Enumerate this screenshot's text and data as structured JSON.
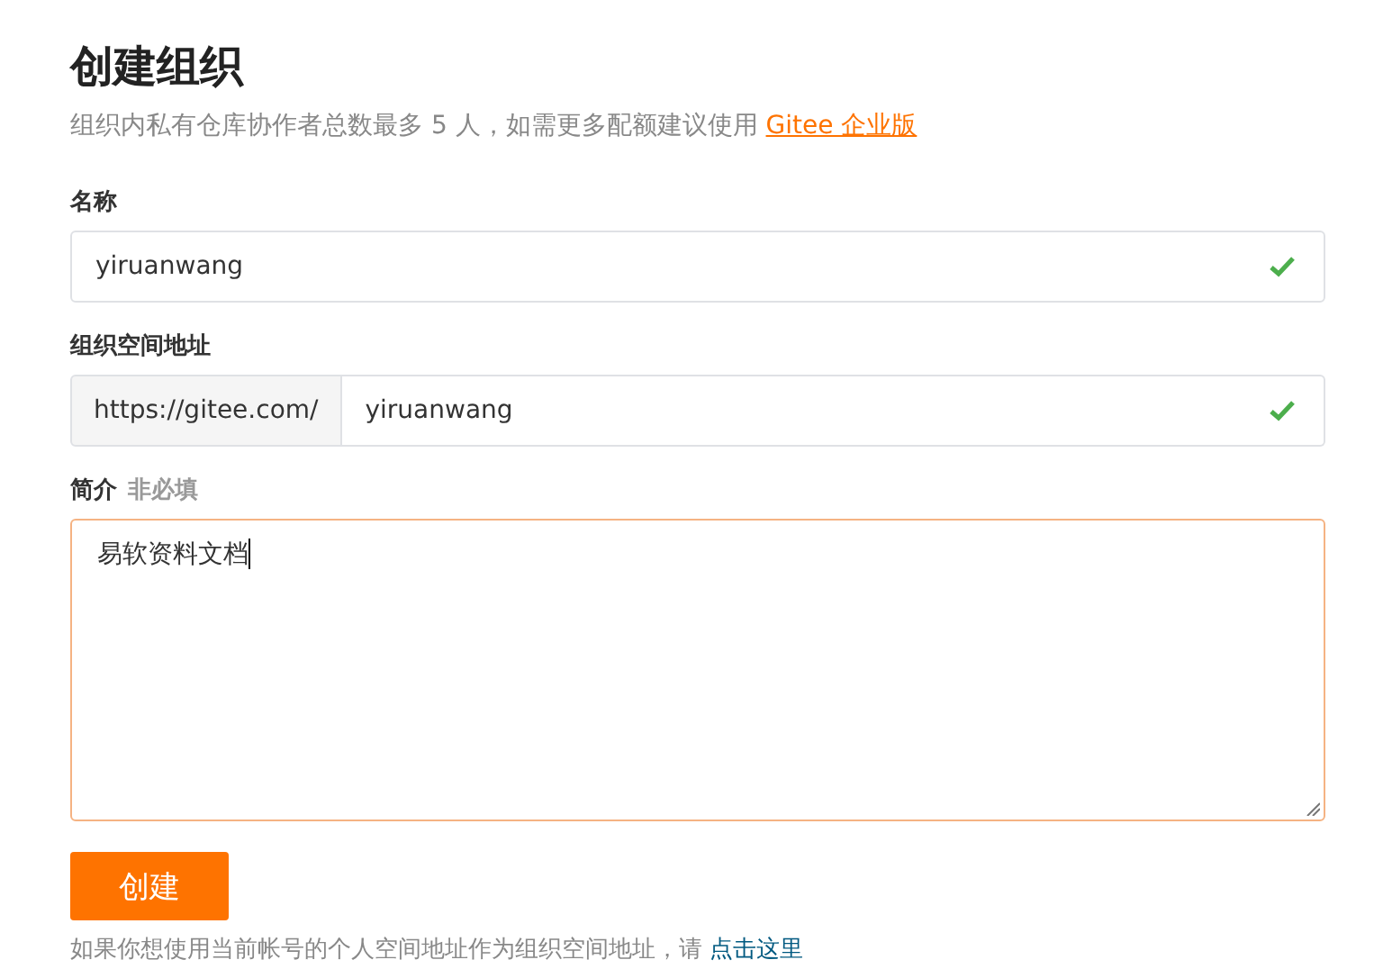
{
  "title": "创建组织",
  "subtitle": {
    "text": "组织内私有仓库协作者总数最多 5 人，如需更多配额建议使用",
    "link": "Gitee 企业版"
  },
  "fields": [
    {
      "kind": "input",
      "label": "名称",
      "value": "yiruanwang",
      "valid": true
    },
    {
      "kind": "prefixed",
      "label": "组织空间地址",
      "prefix": "https://gitee.com/",
      "value": "yiruanwang",
      "valid": true
    },
    {
      "kind": "textarea",
      "label": "简介",
      "hint": "非必填",
      "value": "易软资料文档",
      "focused": true
    }
  ],
  "submit": "创建",
  "footer": {
    "text": "如果你想使用当前帐号的个人空间地址作为组织空间地址，请",
    "link": "点击这里"
  }
}
